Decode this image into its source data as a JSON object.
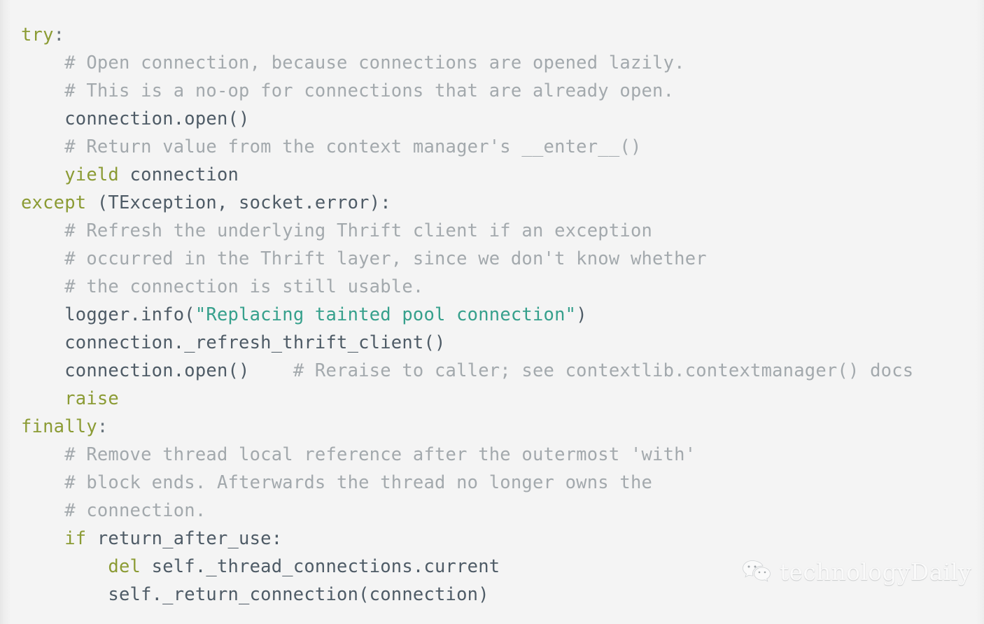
{
  "theme": {
    "background": "#f4f4f4",
    "keyword_color": "#8b9b34",
    "comment_color": "#a3a9ad",
    "string_color": "#36a08c",
    "code_color": "#4e5b66"
  },
  "code": {
    "language": "python",
    "lines": [
      {
        "indent": 0,
        "tokens": [
          {
            "t": "kw",
            "s": "try"
          },
          {
            "t": "punct",
            "s": ":"
          }
        ]
      },
      {
        "indent": 1,
        "tokens": [
          {
            "t": "cmt",
            "s": "# Open connection, because connections are opened lazily."
          }
        ]
      },
      {
        "indent": 1,
        "tokens": [
          {
            "t": "cmt",
            "s": "# This is a no-op for connections that are already open."
          }
        ]
      },
      {
        "indent": 1,
        "tokens": [
          {
            "t": "plain",
            "s": "connection.open()"
          }
        ]
      },
      {
        "indent": 1,
        "tokens": [
          {
            "t": "cmt",
            "s": "# Return value from the context manager's __enter__()"
          }
        ]
      },
      {
        "indent": 1,
        "tokens": [
          {
            "t": "kw",
            "s": "yield"
          },
          {
            "t": "plain",
            "s": " connection"
          }
        ]
      },
      {
        "indent": 0,
        "tokens": [
          {
            "t": "kw",
            "s": "except"
          },
          {
            "t": "plain",
            "s": " (TException, socket.error):"
          }
        ]
      },
      {
        "indent": 1,
        "tokens": [
          {
            "t": "cmt",
            "s": "# Refresh the underlying Thrift client if an exception"
          }
        ]
      },
      {
        "indent": 1,
        "tokens": [
          {
            "t": "cmt",
            "s": "# occurred in the Thrift layer, since we don't know whether"
          }
        ]
      },
      {
        "indent": 1,
        "tokens": [
          {
            "t": "cmt",
            "s": "# the connection is still usable."
          }
        ]
      },
      {
        "indent": 1,
        "tokens": [
          {
            "t": "plain",
            "s": "logger.info("
          },
          {
            "t": "str",
            "s": "\"Replacing tainted pool connection\""
          },
          {
            "t": "plain",
            "s": ")"
          }
        ]
      },
      {
        "indent": 1,
        "tokens": [
          {
            "t": "plain",
            "s": "connection._refresh_thrift_client()"
          }
        ]
      },
      {
        "indent": 1,
        "tokens": [
          {
            "t": "plain",
            "s": "connection.open()"
          },
          {
            "t": "cmt",
            "s": "    # Reraise to caller; see contextlib.contextmanager() docs"
          }
        ]
      },
      {
        "indent": 1,
        "tokens": [
          {
            "t": "kw",
            "s": "raise"
          }
        ]
      },
      {
        "indent": 0,
        "tokens": [
          {
            "t": "kw",
            "s": "finally"
          },
          {
            "t": "punct",
            "s": ":"
          }
        ]
      },
      {
        "indent": 1,
        "tokens": [
          {
            "t": "cmt",
            "s": "# Remove thread local reference after the outermost 'with'"
          }
        ]
      },
      {
        "indent": 1,
        "tokens": [
          {
            "t": "cmt",
            "s": "# block ends. Afterwards the thread no longer owns the"
          }
        ]
      },
      {
        "indent": 1,
        "tokens": [
          {
            "t": "cmt",
            "s": "# connection."
          }
        ]
      },
      {
        "indent": 1,
        "tokens": [
          {
            "t": "kw",
            "s": "if"
          },
          {
            "t": "plain",
            "s": " return_after_use:"
          }
        ]
      },
      {
        "indent": 2,
        "tokens": [
          {
            "t": "kw",
            "s": "del"
          },
          {
            "t": "plain",
            "s": " self._thread_connections.current"
          }
        ]
      },
      {
        "indent": 2,
        "tokens": [
          {
            "t": "plain",
            "s": "self._return_connection(connection)"
          }
        ]
      }
    ]
  },
  "watermark": {
    "logo": "wechat-logo",
    "text": "technologyDaily"
  }
}
